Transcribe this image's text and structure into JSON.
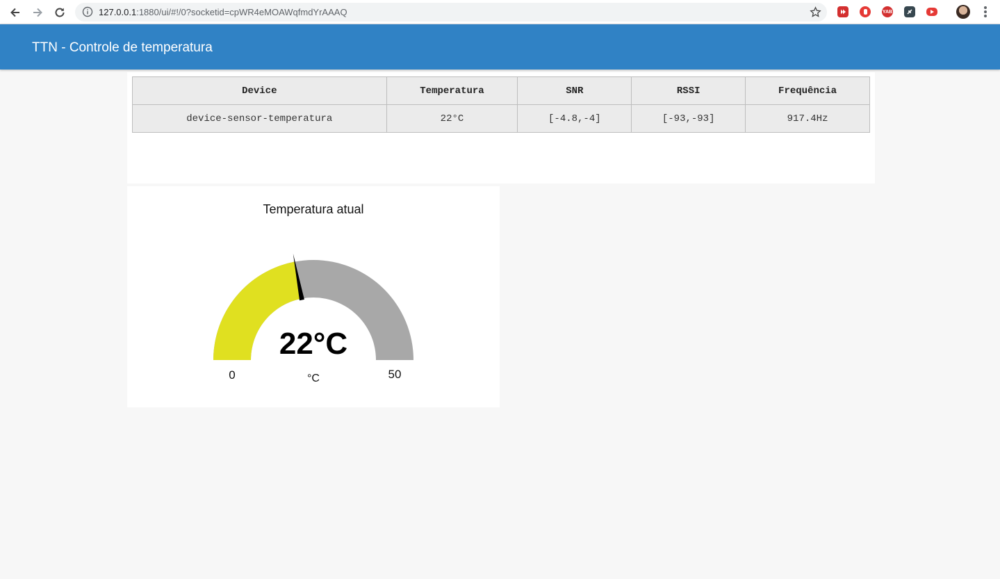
{
  "browser": {
    "url_host": "127.0.0.1",
    "url_rest": ":1880/ui/#!/0?socketid=cpWR4eMOAWqfmdYrAAAQ",
    "extensions": [
      {
        "icon": "video-speed-icon",
        "color": "#e53935"
      },
      {
        "icon": "stop-hand-icon",
        "color": "#e53935"
      },
      {
        "icon": "yab-icon",
        "color": "#d32f2f",
        "label": "YAB"
      },
      {
        "icon": "link-icon",
        "color": "#455a64"
      },
      {
        "icon": "youtube-icon",
        "color": "#e53935"
      }
    ]
  },
  "header": {
    "title": "TTN - Controle de temperatura"
  },
  "table": {
    "columns": [
      "Device",
      "Temperatura",
      "SNR",
      "RSSI",
      "Frequência"
    ],
    "rows": [
      [
        "device-sensor-temperatura",
        "22°C",
        "[-4.8,-4]",
        "[-93,-93]",
        "917.4Hz"
      ]
    ]
  },
  "gauge": {
    "title": "Temperatura atual",
    "value": 22,
    "value_label": "22°C",
    "min": 0,
    "max": 50,
    "min_label": "0",
    "max_label": "50",
    "units": "°C",
    "fill_color": "#e0e020",
    "track_color": "#a8a8a8",
    "needle_color": "#000000"
  },
  "colors": {
    "header_bg": "#3082c5",
    "page_bg": "#f7f7f7"
  }
}
